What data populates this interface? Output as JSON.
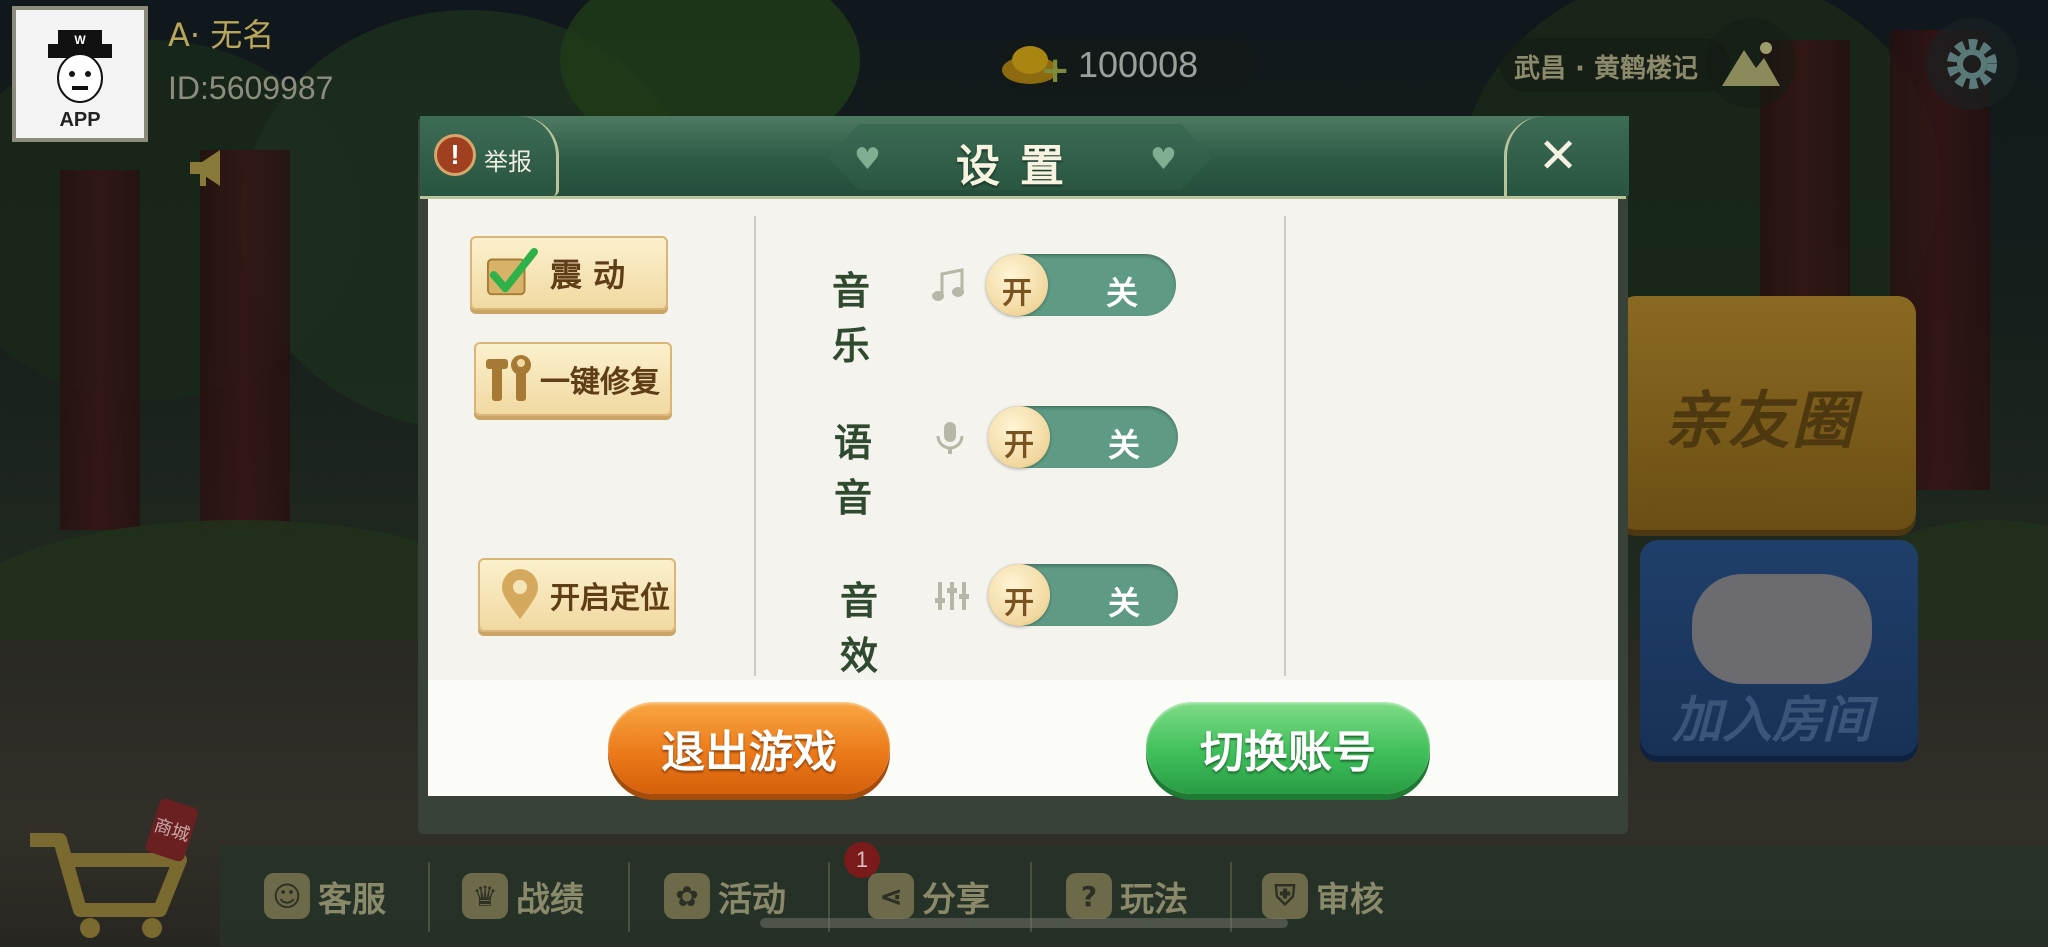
{
  "player": {
    "avatar_label": "APP",
    "name": "A· 无名",
    "id": "ID:5609987"
  },
  "hud": {
    "gold_value": "100008",
    "location": "武昌 · 黄鹤楼记"
  },
  "side_cards": {
    "friends_circle": "亲友圈",
    "join_room": "加入房间"
  },
  "bottom_nav": {
    "shop_badge": "商城",
    "items": [
      {
        "label": "客服",
        "icon": "customer-service-icon"
      },
      {
        "label": "战绩",
        "icon": "trophy-icon"
      },
      {
        "label": "活动",
        "icon": "gift-icon"
      },
      {
        "label": "分享",
        "icon": "share-icon"
      },
      {
        "label": "玩法",
        "icon": "question-icon"
      },
      {
        "label": "审核",
        "icon": "shield-icon"
      }
    ],
    "share_badge_count": "1"
  },
  "settings_dialog": {
    "title": "设置",
    "report_label": "举报",
    "close_glyph": "✕",
    "left_buttons": {
      "vibrate": "震 动",
      "vibrate_checked": true,
      "repair": "一键修复",
      "location": "开启定位"
    },
    "toggles": [
      {
        "label": "音乐",
        "icon": "music-note-icon",
        "on_text": "开",
        "off_text": "关",
        "state": "开"
      },
      {
        "label": "语音",
        "icon": "microphone-icon",
        "on_text": "开",
        "off_text": "关",
        "state": "开"
      },
      {
        "label": "音效",
        "icon": "equalizer-icon",
        "on_text": "开",
        "off_text": "关",
        "state": "开"
      }
    ],
    "exit_button": "退出游戏",
    "switch_account_button": "切换账号"
  },
  "colors": {
    "header_green": "#2d5a45",
    "toggle_green": "#5e9a84",
    "exit_orange": "#ec7a1a",
    "switch_green": "#3fbf5a"
  }
}
